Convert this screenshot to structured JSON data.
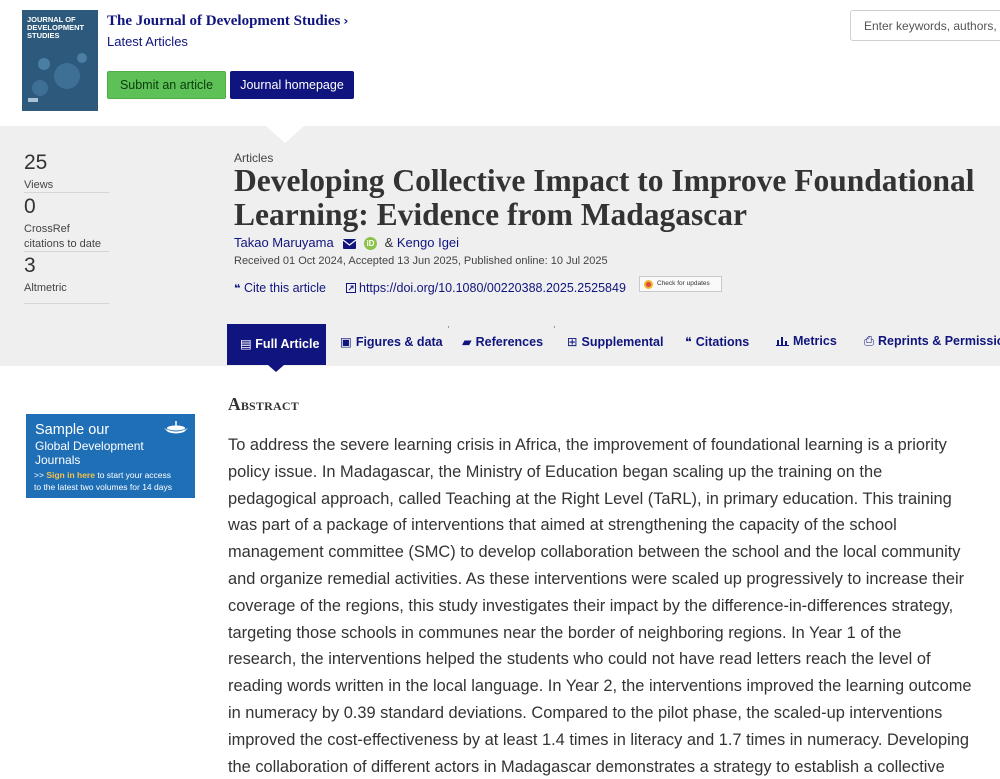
{
  "header": {
    "cover_title": "JOURNAL OF DEVELOPMENT STUDIES",
    "journal_name": "The Journal of Development Studies",
    "latest_articles": "Latest Articles",
    "submit_label": "Submit an article",
    "homepage_label": "Journal homepage",
    "search_placeholder": "Enter keywords, authors, DOI, ORCID, etc."
  },
  "metrics": [
    {
      "value": "25",
      "label": "Views"
    },
    {
      "value": "0",
      "label": "CrossRef citations to date"
    },
    {
      "value": "3",
      "label": "Altmetric"
    }
  ],
  "article": {
    "type": "Articles",
    "title": "Developing Collective Impact to Improve Foundational Learning: Evidence from Madagascar",
    "author1": "Takao Maruyama",
    "author_sep": "&",
    "author2": "Kengo Igei",
    "dates": "Received 01 Oct 2024, Accepted 13 Jun 2025, Published online: 10 Jul 2025",
    "cite_label": "Cite this article",
    "doi": "https://doi.org/10.1080/00220388.2025.2525849",
    "updates_label": "Check for updates"
  },
  "tabs": [
    {
      "label": "Full Article",
      "icon": "document-icon"
    },
    {
      "label": "Figures & data",
      "icon": "image-icon"
    },
    {
      "label": "References",
      "icon": "book-icon"
    },
    {
      "label": "Supplemental",
      "icon": "plus-square-icon"
    },
    {
      "label": "Citations",
      "icon": "quote-icon"
    },
    {
      "label": "Metrics",
      "icon": "bar-chart-icon"
    },
    {
      "label": "Reprints & Permissions",
      "icon": "print-icon"
    }
  ],
  "ad": {
    "line1": "Sample our",
    "line2": "Global Development",
    "line3": "Journals",
    "arrows": ">>",
    "sign_in": "Sign in here",
    "line4_rest": "to start your access",
    "line5": "to the latest two volumes for 14 days"
  },
  "abstract": {
    "heading": "Abstract",
    "text": "To address the severe learning crisis in Africa, the improvement of foundational learning is a priority policy issue. In Madagascar, the Ministry of Education began scaling up the training on the pedagogical approach, called Teaching at the Right Level (TaRL), in primary education. This training was part of a package of interventions that aimed at strengthening the capacity of the school management committee (SMC) to develop collaboration between the school and the local community and organize remedial activities. As these interventions were scaled up progressively to increase their coverage of the regions, this study investigates their impact by the difference-in-differences strategy, targeting those schools in communes near the border of neighboring regions. In Year 1 of the research, the interventions helped the students who could not have read letters reach the level of reading words written in the local language. In Year 2, the interventions improved the learning outcome in numeracy by 0.39 standard deviations. Compared to the pilot phase, the scaled-up interventions improved the cost-effectiveness by at least 1.4 times in literacy and 1.7 times in numeracy. Developing the collaboration of different actors in Madagascar demonstrates a strategy to establish a collective impact to address the learning crisis."
  },
  "colors": {
    "brand_navy": "#10147e",
    "submit_green": "#5ec157",
    "band_grey": "#efefef",
    "ad_blue": "#1f6fb7"
  }
}
